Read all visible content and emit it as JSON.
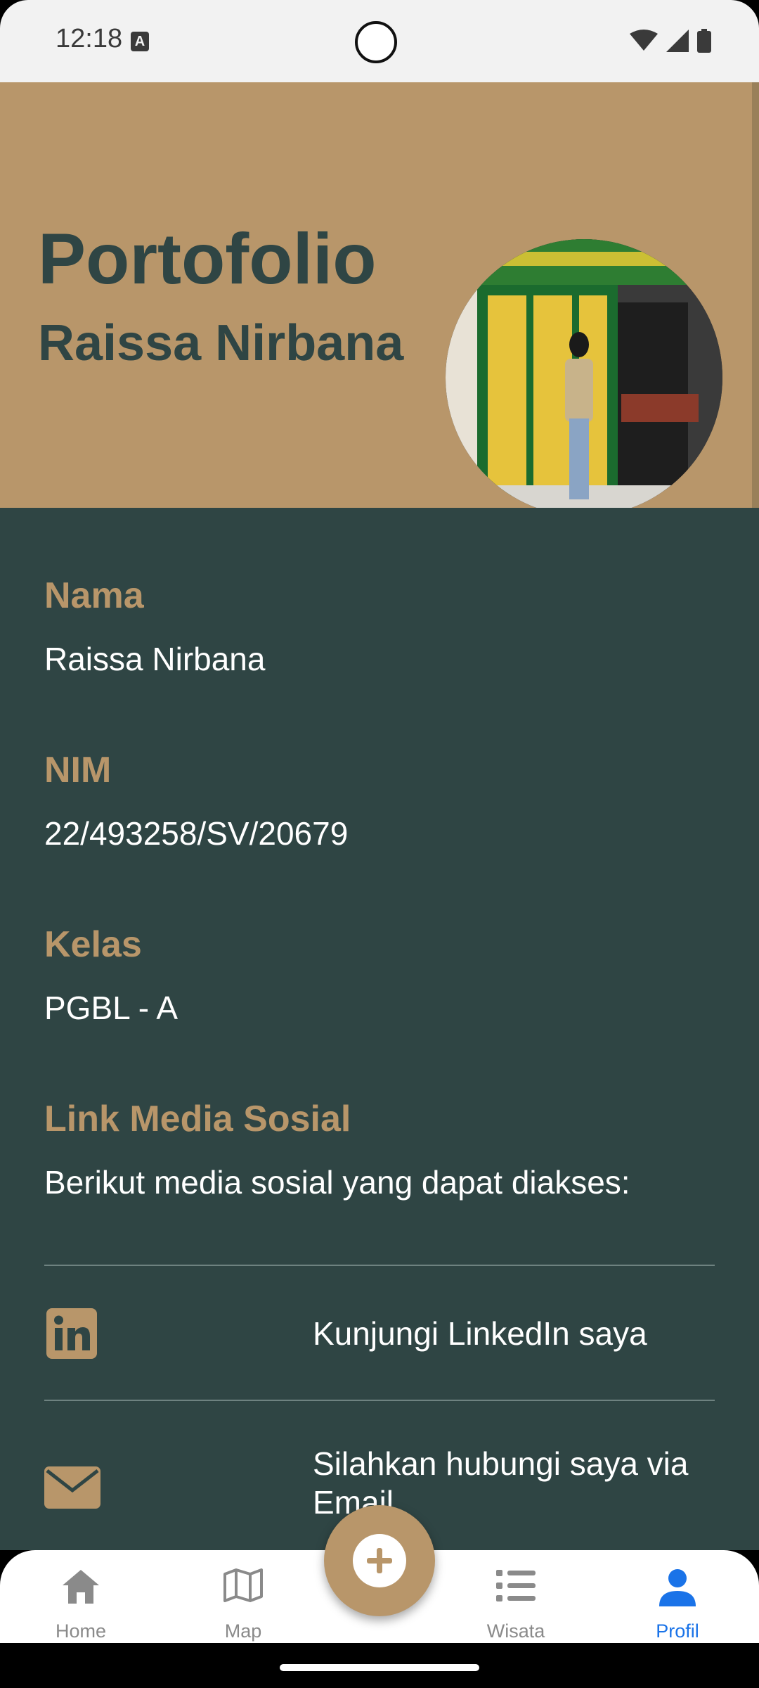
{
  "status_bar": {
    "time": "12:18"
  },
  "header": {
    "title": "Portofolio",
    "subtitle": "Raissa Nirbana"
  },
  "profile": {
    "name_label": "Nama",
    "name_value": "Raissa Nirbana",
    "nim_label": "NIM",
    "nim_value": "22/493258/SV/20679",
    "kelas_label": "Kelas",
    "kelas_value": "PGBL - A",
    "social_label": "Link Media Sosial",
    "social_desc": "Berikut media sosial yang dapat diakses:"
  },
  "social": {
    "linkedin_text": "Kunjungi LinkedIn saya",
    "email_text": "Silahkan hubungi saya via Email"
  },
  "nav": {
    "items": [
      {
        "label": "Home",
        "icon": "home-icon"
      },
      {
        "label": "Map",
        "icon": "map-icon"
      },
      {
        "label": "Wisata",
        "icon": "list-icon"
      },
      {
        "label": "Profil",
        "icon": "person-icon"
      }
    ],
    "active": "Profil"
  },
  "colors": {
    "accent": "#b8966a",
    "dark": "#2f4544",
    "active": "#1a73e8"
  }
}
